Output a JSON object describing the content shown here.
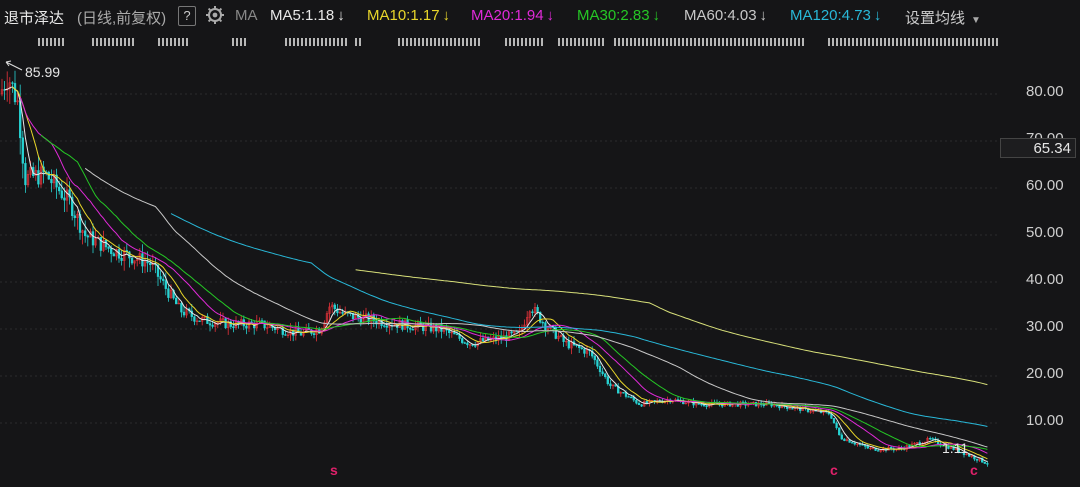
{
  "toolbar": {
    "stock_name": "退市泽达",
    "period_label": "(日线,前复权)",
    "help_label": "?",
    "settings_icon": "gear-icon",
    "ma_label": "MA",
    "ma_items": [
      {
        "label": "MA5:1.18",
        "color": "#e8e8e8"
      },
      {
        "label": "MA10:1.17",
        "color": "#e8d62a"
      },
      {
        "label": "MA20:1.94",
        "color": "#e02ad8"
      },
      {
        "label": "MA30:2.83",
        "color": "#25c725"
      },
      {
        "label": "MA60:4.03",
        "color": "#c8c8c8"
      },
      {
        "label": "MA120:4.73",
        "color": "#29b8d8"
      }
    ],
    "arrow": "↓",
    "settings_link": "设置均线"
  },
  "price_axis": {
    "labels": [
      "80.00",
      "70.00",
      "60.00",
      "50.00",
      "40.00",
      "30.00",
      "20.00",
      "10.00"
    ],
    "current_price": "65.34"
  },
  "annotations": {
    "high": "85.99",
    "low": "1.11"
  },
  "markers": [
    "s",
    "c",
    "c"
  ],
  "colors": {
    "up": "#e8333a",
    "down": "#27d2d2",
    "background": "#151517",
    "ma5": "#e8e8e8",
    "ma10": "#e8d62a",
    "ma20": "#e02ad8",
    "ma30": "#25c725",
    "ma60": "#c8c8c8",
    "ma120": "#29b8d8",
    "ma250": "#d8e07a"
  }
}
